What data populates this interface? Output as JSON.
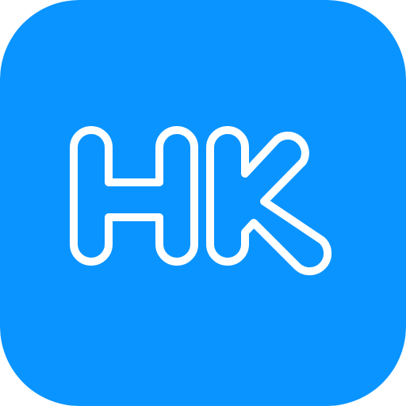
{
  "icon": {
    "text": "HK",
    "background_color": "#0A94FF",
    "glyph_outline_color": "#FFFFFF",
    "style": "outlined-letters-on-rounded-square"
  }
}
